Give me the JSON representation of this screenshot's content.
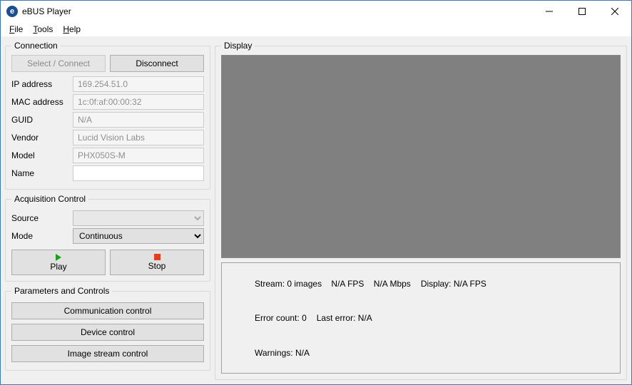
{
  "window": {
    "title": "eBUS Player",
    "icon_letter": "e"
  },
  "menu": {
    "file": "File",
    "tools": "Tools",
    "help": "Help"
  },
  "connection": {
    "legend": "Connection",
    "select_connect_label": "Select / Connect",
    "disconnect_label": "Disconnect",
    "ip_label": "IP address",
    "ip_value": "169.254.51.0",
    "mac_label": "MAC address",
    "mac_value": "1c:0f:af:00:00:32",
    "guid_label": "GUID",
    "guid_value": "N/A",
    "vendor_label": "Vendor",
    "vendor_value": "Lucid Vision Labs",
    "model_label": "Model",
    "model_value": "PHX050S-M",
    "name_label": "Name",
    "name_value": ""
  },
  "acq": {
    "legend": "Acquisition Control",
    "source_label": "Source",
    "source_value": "",
    "mode_label": "Mode",
    "mode_value": "Continuous",
    "play_label": "Play",
    "stop_label": "Stop"
  },
  "params": {
    "legend": "Parameters and Controls",
    "comm_label": "Communication control",
    "device_label": "Device control",
    "stream_label": "Image stream control"
  },
  "display": {
    "legend": "Display",
    "stream_label": "Stream:",
    "stream_images": "0 images",
    "stream_fps": "N/A FPS",
    "stream_mbps": "N/A Mbps",
    "display_label": "Display:",
    "display_fps": "N/A FPS",
    "error_count_label": "Error count:",
    "error_count_value": "0",
    "last_error_label": "Last error:",
    "last_error_value": "N/A",
    "warnings_label": "Warnings:",
    "warnings_value": "N/A"
  }
}
